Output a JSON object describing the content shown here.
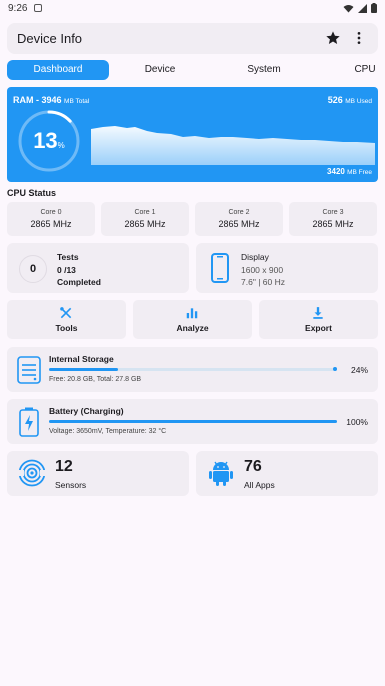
{
  "status_bar": {
    "time": "9:26"
  },
  "app_bar": {
    "title": "Device Info",
    "star_icon": "star-icon",
    "more_icon": "more-vert-icon"
  },
  "tabs": [
    {
      "label": "Dashboard",
      "active": true
    },
    {
      "label": "Device",
      "active": false
    },
    {
      "label": "System",
      "active": false
    },
    {
      "label": "CPU",
      "active": false
    }
  ],
  "ram": {
    "title": "RAM - 3946",
    "total_unit": "MB Total",
    "used_value": "526",
    "used_unit": "MB Used",
    "free_value": "3420",
    "free_unit": "MB Free",
    "percent": "13",
    "percent_unit": "%",
    "usage_fraction": 0.13
  },
  "cpu_status": {
    "title": "CPU Status",
    "cores": [
      {
        "name": "Core 0",
        "freq": "2865 MHz"
      },
      {
        "name": "Core 1",
        "freq": "2865 MHz"
      },
      {
        "name": "Core 2",
        "freq": "2865 MHz"
      },
      {
        "name": "Core 3",
        "freq": "2865 MHz"
      }
    ]
  },
  "tests": {
    "count": "0",
    "title": "Tests",
    "progress": "0 /13",
    "status": "Completed"
  },
  "display": {
    "title": "Display",
    "resolution": "1600 x 900",
    "spec": "7.6\" | 60 Hz",
    "icon": "phone-icon"
  },
  "actions": [
    {
      "label": "Tools",
      "icon": "tools-icon"
    },
    {
      "label": "Analyze",
      "icon": "bar-chart-icon"
    },
    {
      "label": "Export",
      "icon": "download-icon"
    }
  ],
  "storage": {
    "title": "Internal Storage",
    "detail": "Free: 20.8 GB,  Total: 27.8 GB",
    "percent": "24%",
    "fraction": 0.24,
    "icon": "storage-icon"
  },
  "battery": {
    "title": "Battery (Charging)",
    "detail": "Voltage: 3650mV,  Temperature: 32 °C",
    "percent": "100%",
    "fraction": 1.0,
    "icon": "battery-charging-icon"
  },
  "sensors": {
    "count": "12",
    "label": "Sensors",
    "icon": "sensors-icon"
  },
  "apps": {
    "count": "76",
    "label": "All Apps",
    "icon": "android-icon"
  },
  "colors": {
    "accent": "#2196f3",
    "card": "#f1edf3",
    "background": "#fcf7fd"
  }
}
